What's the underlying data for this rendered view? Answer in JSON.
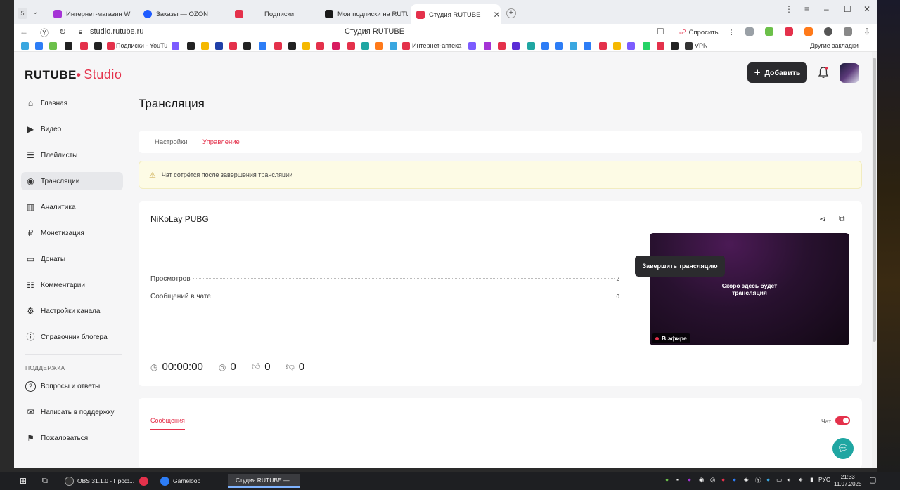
{
  "browser": {
    "tab_counter": "5",
    "tabs": [
      {
        "label": "Интернет-магазин Wildb",
        "color": "#a533d6"
      },
      {
        "label": "Заказы — OZON",
        "color": "#1f5cff"
      },
      {
        "label": "Подписки",
        "color": "#e4314b"
      },
      {
        "label": "Мои подписки на RUTUBE",
        "color": "#1a1a1a"
      },
      {
        "label": "Студия RUTUBE",
        "color": "#e4314b"
      }
    ],
    "url": "studio.rutube.ru",
    "page_title": "Студия RUTUBE",
    "ask_label": "Спросить",
    "bookmarks": {
      "subscriptions_youtube": "Подписки - YouTu",
      "pharmacy": "Интернет-аптека",
      "vpn": "VPN",
      "other": "Другие закладки"
    }
  },
  "header": {
    "logo_main": "RUTUBE",
    "logo_studio": "Studio",
    "add_button": "Добавить"
  },
  "sidebar": {
    "items": [
      {
        "label": "Главная",
        "icon": "home-icon",
        "glyph": "⌂"
      },
      {
        "label": "Видео",
        "icon": "video-icon",
        "glyph": "▶"
      },
      {
        "label": "Плейлисты",
        "icon": "playlist-icon",
        "glyph": "☰"
      },
      {
        "label": "Трансляции",
        "icon": "broadcast-icon",
        "glyph": "◉"
      },
      {
        "label": "Аналитика",
        "icon": "analytics-icon",
        "glyph": "▥"
      },
      {
        "label": "Монетизация",
        "icon": "ruble-icon",
        "glyph": "₽"
      },
      {
        "label": "Донаты",
        "icon": "wallet-icon",
        "glyph": "▭"
      },
      {
        "label": "Комментарии",
        "icon": "comment-icon",
        "glyph": "☷"
      },
      {
        "label": "Настройки канала",
        "icon": "gear-icon",
        "glyph": "⚙"
      },
      {
        "label": "Справочник блогера",
        "icon": "info-icon",
        "glyph": "ⓘ"
      }
    ],
    "support_heading": "Поддержка",
    "support_items": [
      {
        "label": "Вопросы и ответы",
        "icon": "question-icon",
        "glyph": "?"
      },
      {
        "label": "Написать в поддержку",
        "icon": "mail-icon",
        "glyph": "✉"
      },
      {
        "label": "Пожаловаться",
        "icon": "flag-icon",
        "glyph": "⚑"
      }
    ]
  },
  "main": {
    "title": "Трансляция",
    "tabs": [
      "Настройки",
      "Управление"
    ],
    "notice": "Чат сотрётся после завершения трансляции",
    "stream": {
      "name": "NiKoLay PUBG",
      "stats": [
        {
          "label": "Просмотров",
          "value": "2"
        },
        {
          "label": "Сообщений в чате",
          "value": "0"
        }
      ],
      "preview_line1": "Скоро здесь будет",
      "preview_line2": "трансляция",
      "live_label": "В эфире",
      "duration": "00:00:00",
      "viewers": "0",
      "likes": "0",
      "dislikes": "0",
      "end_button": "Завершить трансляцию"
    },
    "messages": {
      "tab": "Сообщения",
      "chat_label": "Чат",
      "chat_enabled": true
    }
  },
  "taskbar": {
    "tasks": [
      "OBS 31.1.0 - Проф...",
      "Gameloop",
      "Студия RUTUBE — ..."
    ],
    "lang": "РУС",
    "time": "21:33",
    "date": "11.07.2025"
  },
  "colors": {
    "accent": "#e4314b",
    "dark_button": "#2b2b2e",
    "fab": "#1fa6a2"
  }
}
